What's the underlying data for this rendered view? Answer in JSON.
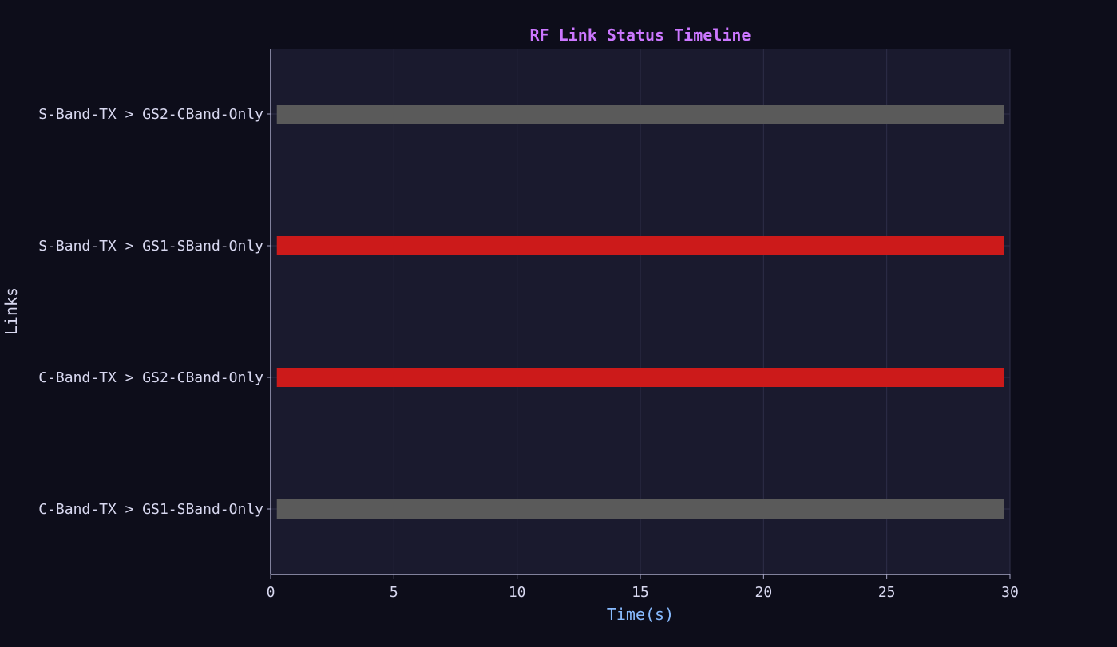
{
  "chart_data": {
    "type": "bar",
    "orientation": "horizontal-timeline",
    "title": "RF Link Status Timeline",
    "xlabel": "Time(s)",
    "ylabel": "Links",
    "xlim": [
      0,
      30
    ],
    "xticks": [
      0,
      5,
      10,
      15,
      20,
      25,
      30
    ],
    "xtick_labels": [
      "0",
      "5",
      "10",
      "15",
      "20",
      "25",
      "30"
    ],
    "grid": true,
    "categories": [
      "S-Band-TX > GS2-CBand-Only",
      "S-Band-TX > GS1-SBand-Only",
      "C-Band-TX > GS2-CBand-Only",
      "C-Band-TX > GS1-SBand-Only"
    ],
    "segments": [
      {
        "link": "S-Band-TX > GS2-CBand-Only",
        "start": 0.25,
        "end": 29.75,
        "color": "#5a5a5a"
      },
      {
        "link": "S-Band-TX > GS1-SBand-Only",
        "start": 0.25,
        "end": 29.75,
        "color": "#cc1a1a"
      },
      {
        "link": "C-Band-TX > GS2-CBand-Only",
        "start": 0.25,
        "end": 29.75,
        "color": "#cc1a1a"
      },
      {
        "link": "C-Band-TX > GS1-SBand-Only",
        "start": 0.25,
        "end": 29.75,
        "color": "#5a5a5a"
      }
    ]
  },
  "colors": {
    "background": "#0d0d1a",
    "plot_background": "#1a1a2e",
    "title": "#cc77ff",
    "xlabel": "#88bbff",
    "text": "#d8d8f0",
    "grid": "#2e2e48",
    "axis": "#a8a8c8"
  }
}
